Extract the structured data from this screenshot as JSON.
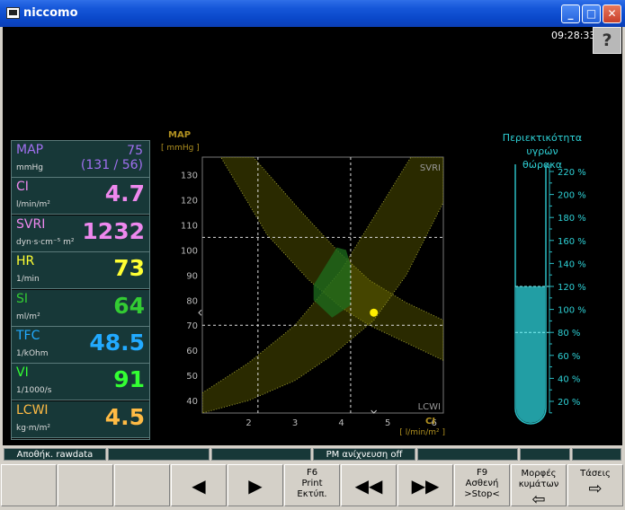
{
  "window": {
    "title": "niccomo",
    "min": "_",
    "max": "□",
    "close": "✕"
  },
  "clock": "09:28:33",
  "help_label": "?",
  "params": [
    {
      "name": "MAP",
      "unit": "mmHg",
      "value": "75",
      "sub": "(131 / 56)",
      "color": "#a070f0"
    },
    {
      "name": "CI",
      "unit": "l/min/m²",
      "value": "4.7",
      "color": "#ee88ee"
    },
    {
      "name": "SVRI",
      "unit": "dyn·s·cm⁻⁵ m²",
      "value": "1232",
      "color": "#ee88ee"
    },
    {
      "name": "HR",
      "unit": "1/min",
      "value": "73",
      "color": "#ffff33"
    },
    {
      "name": "SI",
      "unit": "ml/m²",
      "value": "64",
      "color": "#33cc33"
    },
    {
      "name": "TFC",
      "unit": "1/kOhm",
      "value": "48.5",
      "color": "#22aaff"
    },
    {
      "name": "VI",
      "unit": "1/1000/s",
      "value": "91",
      "color": "#33ff33"
    },
    {
      "name": "LCWI",
      "unit": "kg·m/m²",
      "value": "4.5",
      "color": "#ffbb44"
    }
  ],
  "chart_data": {
    "type": "scatter",
    "y_label": "MAP",
    "y_unit": "[ mmHg ]",
    "x_label": "CI",
    "x_unit": "[ l/min/m² ]",
    "xlim": [
      1.0,
      6.2
    ],
    "ylim": [
      35,
      137
    ],
    "x_ticks": [
      2,
      3,
      4,
      5,
      6
    ],
    "y_ticks": [
      40,
      50,
      60,
      70,
      80,
      90,
      100,
      110,
      120,
      130
    ],
    "band_labels": [
      "SVRI",
      "LCWI"
    ],
    "reference_lines": {
      "x": [
        2.2,
        4.2
      ],
      "y": [
        70,
        105
      ]
    },
    "point": {
      "x": 4.7,
      "y": 75
    }
  },
  "tfc_gauge": {
    "title_line1": "Περιεκτικότητα υγρών",
    "title_line2": "θώρακα",
    "ticks": [
      "220 %",
      "200 %",
      "180 %",
      "160 %",
      "140 %",
      "120 %",
      "100 %",
      "80 %",
      "60 %",
      "40 %",
      "20 %"
    ],
    "level_percent": 120,
    "ref_lines_percent": [
      120,
      80
    ]
  },
  "status": [
    "Αποθήκ. rawdata",
    "",
    "",
    "PM ανίχνευση off",
    "",
    "",
    ""
  ],
  "fkeys": [
    {
      "lines": []
    },
    {
      "lines": []
    },
    {
      "lines": []
    },
    {
      "icon": "◀"
    },
    {
      "icon": "▶"
    },
    {
      "lines": [
        "F6",
        "Print",
        "Εκτύπ."
      ]
    },
    {
      "icon": "◀◀"
    },
    {
      "icon": "▶▶"
    },
    {
      "lines": [
        "F9",
        "Ασθενή",
        ">Stop<"
      ]
    },
    {
      "lines": [
        "Μορφές",
        "κυμάτων"
      ],
      "icon": "⇦"
    },
    {
      "lines": [
        "Τάσεις"
      ],
      "icon": "⇨"
    }
  ]
}
